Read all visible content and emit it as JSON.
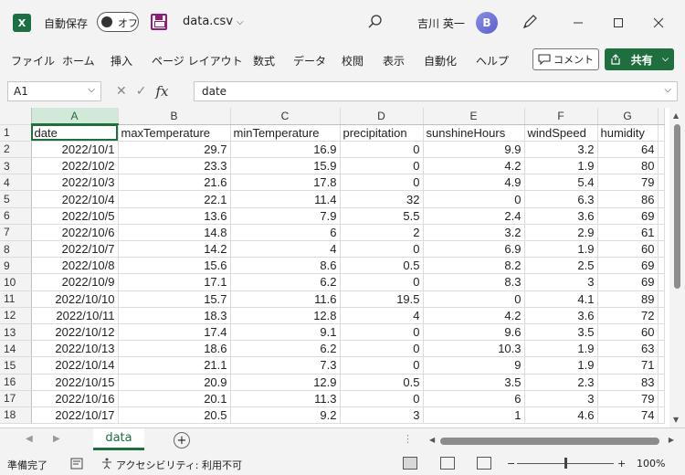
{
  "app": {
    "logo_text": "X",
    "autosave_label": "自動保存",
    "autosave_state": "オフ",
    "doc_title": "data.csv",
    "user_name": "吉川 英一",
    "avatar_text": "B"
  },
  "ribbon": {
    "tabs": [
      "ファイル",
      "ホーム",
      "挿入",
      "ページ レイアウト",
      "数式",
      "データ",
      "校閲",
      "表示",
      "自動化",
      "ヘルプ"
    ],
    "comment_label": "コメント",
    "share_label": "共有"
  },
  "formula_bar": {
    "name_box": "A1",
    "fx_label": "fx",
    "value": "date"
  },
  "grid": {
    "columns": [
      "A",
      "B",
      "C",
      "D",
      "E",
      "F",
      "G"
    ],
    "row_numbers": [
      "1",
      "2",
      "3",
      "4",
      "5",
      "6",
      "7",
      "8",
      "9",
      "10",
      "11",
      "12",
      "13",
      "14",
      "15",
      "16",
      "17",
      "18"
    ],
    "rows": [
      [
        "date",
        "maxTemperature",
        "minTemperature",
        "precipitation",
        "sunshineHours",
        "windSpeed",
        "humidity"
      ],
      [
        "2022/10/1",
        "29.7",
        "16.9",
        "0",
        "9.9",
        "3.2",
        "64"
      ],
      [
        "2022/10/2",
        "23.3",
        "15.9",
        "0",
        "4.2",
        "1.9",
        "80"
      ],
      [
        "2022/10/3",
        "21.6",
        "17.8",
        "0",
        "4.9",
        "5.4",
        "79"
      ],
      [
        "2022/10/4",
        "22.1",
        "11.4",
        "32",
        "0",
        "6.3",
        "86"
      ],
      [
        "2022/10/5",
        "13.6",
        "7.9",
        "5.5",
        "2.4",
        "3.6",
        "69"
      ],
      [
        "2022/10/6",
        "14.8",
        "6",
        "2",
        "3.2",
        "2.9",
        "61"
      ],
      [
        "2022/10/7",
        "14.2",
        "4",
        "0",
        "6.9",
        "1.9",
        "60"
      ],
      [
        "2022/10/8",
        "15.6",
        "8.6",
        "0.5",
        "8.2",
        "2.5",
        "69"
      ],
      [
        "2022/10/9",
        "17.1",
        "6.2",
        "0",
        "8.3",
        "3",
        "69"
      ],
      [
        "2022/10/10",
        "15.7",
        "11.6",
        "19.5",
        "0",
        "4.1",
        "89"
      ],
      [
        "2022/10/11",
        "18.3",
        "12.8",
        "4",
        "4.2",
        "3.6",
        "72"
      ],
      [
        "2022/10/12",
        "17.4",
        "9.1",
        "0",
        "9.6",
        "3.5",
        "60"
      ],
      [
        "2022/10/13",
        "18.6",
        "6.2",
        "0",
        "10.3",
        "1.9",
        "63"
      ],
      [
        "2022/10/14",
        "21.1",
        "7.3",
        "0",
        "9",
        "1.9",
        "71"
      ],
      [
        "2022/10/15",
        "20.9",
        "12.9",
        "0.5",
        "3.5",
        "2.3",
        "83"
      ],
      [
        "2022/10/16",
        "20.1",
        "11.3",
        "0",
        "6",
        "3",
        "79"
      ],
      [
        "2022/10/17",
        "20.5",
        "9.2",
        "3",
        "1",
        "4.6",
        "74"
      ]
    ]
  },
  "sheets": {
    "active": "data",
    "add_label": "+"
  },
  "status": {
    "ready": "準備完了",
    "accessibility": "アクセシビリティ: 利用不可",
    "zoom": "100%",
    "zoom_minus": "−",
    "zoom_plus": "+"
  },
  "colors": {
    "accent": "#1e6e3e"
  }
}
